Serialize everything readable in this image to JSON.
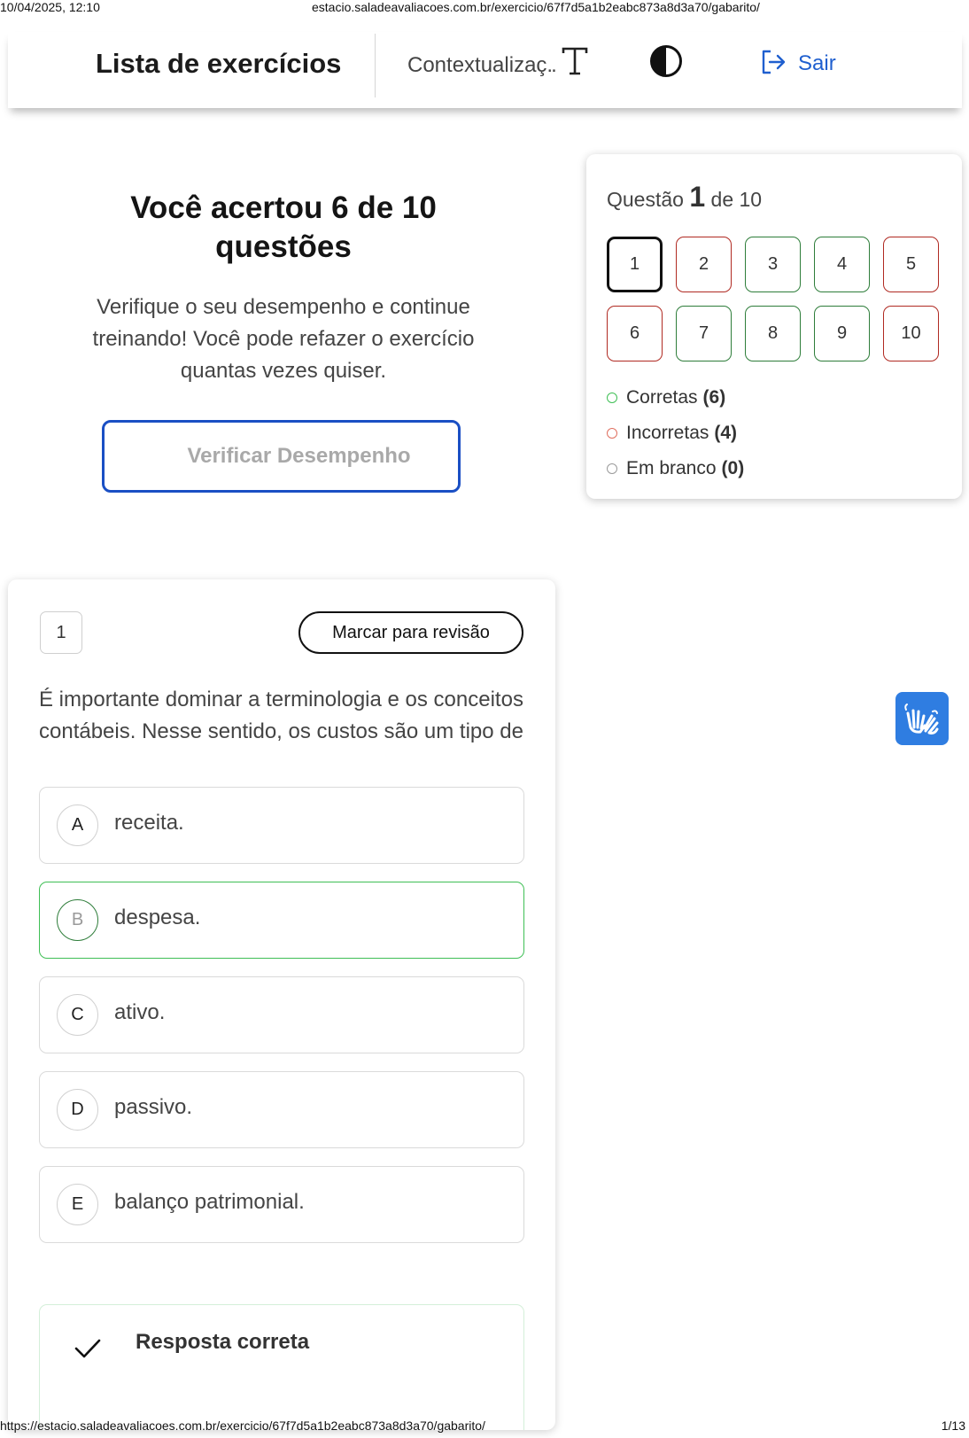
{
  "print_header": {
    "datetime": "10/04/2025, 12:10",
    "url": "estacio.saladeavaliacoes.com.br/exercicio/67f7d5a1b2eabc873a8d3a70/gabarito/"
  },
  "print_footer": {
    "url": "https://estacio.saladeavaliacoes.com.br/exercicio/67f7d5a1b2eabc873a8d3a70/gabarito/",
    "page": "1/13"
  },
  "header": {
    "title": "Lista de exercícios",
    "context_label": "Contextualizaç",
    "context_ellipsis": "..",
    "font_size_icon": "text-size-icon",
    "contrast_icon": "contrast-icon",
    "logout_icon": "logout-icon",
    "logout_label": "Sair",
    "accent_color": "#1f5fcf"
  },
  "result": {
    "title": "Você acertou 6 de 10 questões",
    "message": "Verifique o seu desempenho e continue treinando! Você pode refazer o exercício quantas vezes quiser.",
    "verify_button": "Verificar Desempenho"
  },
  "navigator": {
    "label_prefix": "Questão",
    "current": "1",
    "label_suffix": "de 10",
    "questions": [
      {
        "number": "1",
        "status": "current"
      },
      {
        "number": "2",
        "status": "incorrect"
      },
      {
        "number": "3",
        "status": "correct"
      },
      {
        "number": "4",
        "status": "correct"
      },
      {
        "number": "5",
        "status": "incorrect"
      },
      {
        "number": "6",
        "status": "incorrect"
      },
      {
        "number": "7",
        "status": "correct"
      },
      {
        "number": "8",
        "status": "correct"
      },
      {
        "number": "9",
        "status": "correct"
      },
      {
        "number": "10",
        "status": "incorrect"
      }
    ],
    "legend": [
      {
        "label": "Corretas",
        "count": "(6)",
        "color": "#3fbf55"
      },
      {
        "label": "Incorretas",
        "count": "(4)",
        "color": "#e07060"
      },
      {
        "label": "Em branco",
        "count": "(0)",
        "color": "#9a9a9a"
      }
    ],
    "colors": {
      "correct": "#2e7d3a",
      "incorrect": "#b02a22",
      "current": "#111111"
    }
  },
  "question": {
    "number": "1",
    "review_button": "Marcar para revisão",
    "text": "É importante dominar a terminologia e os conceitos contábeis. Nesse sentido, os custos são um tipo de",
    "options": [
      {
        "letter": "A",
        "text": "receita."
      },
      {
        "letter": "B",
        "text": "despesa.",
        "selected": true
      },
      {
        "letter": "C",
        "text": "ativo."
      },
      {
        "letter": "D",
        "text": "passivo."
      },
      {
        "letter": "E",
        "text": "balanço patrimonial."
      }
    ],
    "feedback_label": "Resposta correta",
    "feedback_icon": "check-icon"
  },
  "accessibility": {
    "libras_icon": "sign-language-hands-icon",
    "color": "#2f7de1"
  }
}
